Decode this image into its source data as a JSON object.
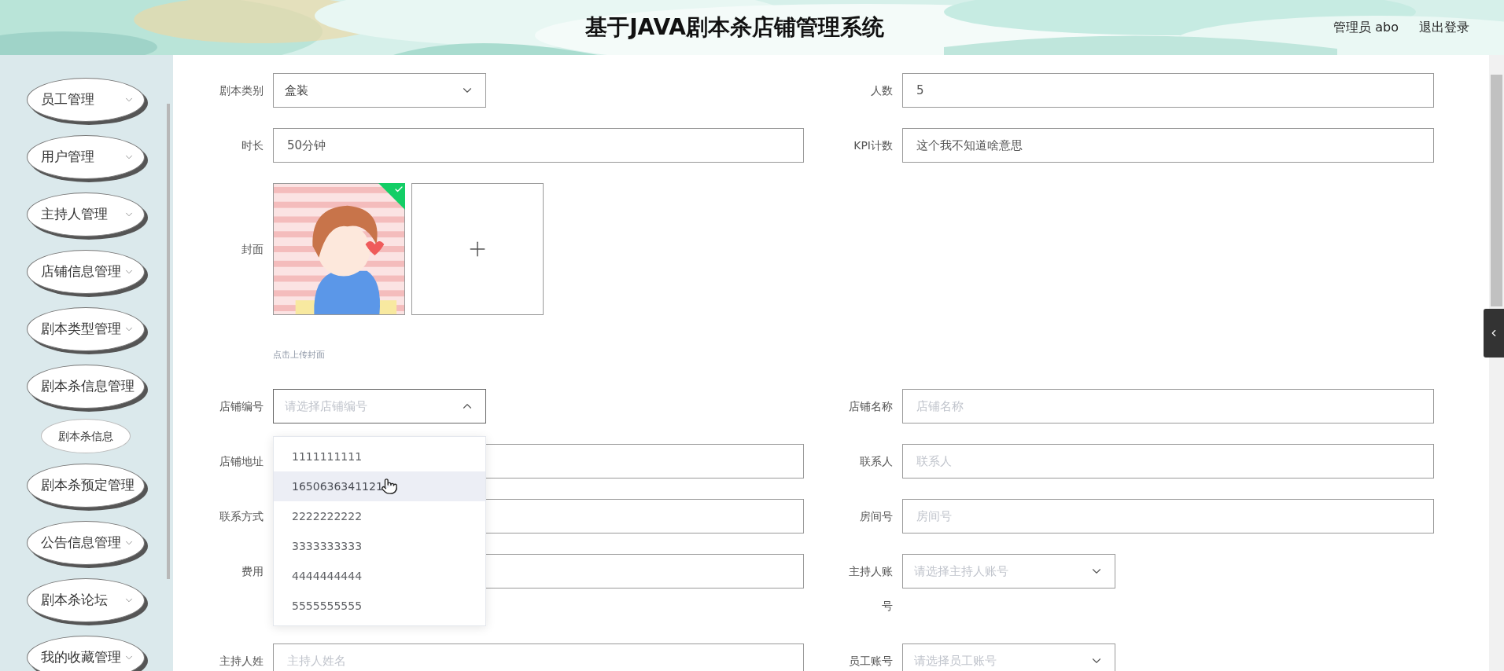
{
  "header": {
    "title": "基于JAVA剧本杀店铺管理系统",
    "user": "管理员 abo",
    "logout": "退出登录"
  },
  "sidebar": {
    "items": [
      {
        "label": "员工管理",
        "expanded": false
      },
      {
        "label": "用户管理",
        "expanded": false
      },
      {
        "label": "主持人管理",
        "expanded": false
      },
      {
        "label": "店铺信息管理",
        "expanded": false
      },
      {
        "label": "剧本类型管理",
        "expanded": false
      },
      {
        "label": "剧本杀信息管理",
        "expanded": true,
        "children": [
          {
            "label": "剧本杀信息"
          }
        ]
      },
      {
        "label": "剧本杀预定管理",
        "expanded": false
      },
      {
        "label": "公告信息管理",
        "expanded": false
      },
      {
        "label": "剧本杀论坛",
        "expanded": false
      },
      {
        "label": "我的收藏管理",
        "expanded": false
      }
    ]
  },
  "form": {
    "rows": [
      [
        {
          "kind": "select",
          "label": "剧本类别",
          "value": "盒装",
          "open": false
        },
        {
          "kind": "input",
          "label": "人数",
          "value": "5"
        }
      ],
      [
        {
          "kind": "input",
          "label": "时长",
          "value": "50分钟"
        },
        {
          "kind": "input",
          "label": "KPI计数",
          "value": "这个我不知道啥意思"
        }
      ],
      [
        {
          "kind": "upload",
          "label": "封面",
          "hint": "点击上传封面",
          "uploaded": true
        }
      ],
      [
        {
          "kind": "select",
          "label": "店铺编号",
          "placeholder": "请选择店铺编号",
          "open": true
        },
        {
          "kind": "input",
          "label": "店铺名称",
          "placeholder": "店铺名称"
        }
      ],
      [
        {
          "kind": "input",
          "label": "店铺地址"
        },
        {
          "kind": "input",
          "label": "联系人",
          "placeholder": "联系人"
        }
      ],
      [
        {
          "kind": "input",
          "label": "联系方式"
        },
        {
          "kind": "input",
          "label": "房间号",
          "placeholder": "房间号"
        }
      ],
      [
        {
          "kind": "input",
          "label": "费用"
        },
        {
          "kind": "select",
          "label": "主持人账号",
          "placeholder": "请选择主持人账号",
          "open": false
        }
      ],
      [
        {
          "kind": "input",
          "label": "主持人姓",
          "placeholder": "主持人姓名"
        },
        {
          "kind": "select",
          "label": "员工账号",
          "placeholder": "请选择员工账号",
          "open": false
        }
      ]
    ]
  },
  "dropdown_menu": {
    "options": [
      {
        "label": "1111111111",
        "highlighted": false
      },
      {
        "label": "1650636341121",
        "highlighted": true
      },
      {
        "label": "2222222222",
        "highlighted": false
      },
      {
        "label": "3333333333",
        "highlighted": false
      },
      {
        "label": "4444444444",
        "highlighted": false
      },
      {
        "label": "5555555555",
        "highlighted": false
      }
    ]
  }
}
